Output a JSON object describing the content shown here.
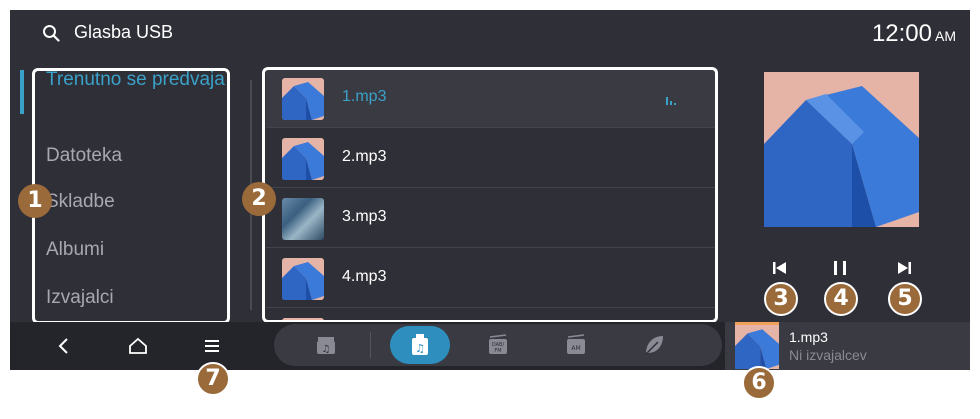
{
  "header": {
    "title": "Glasba USB",
    "time": "12:00",
    "ampm": "AM"
  },
  "menu": {
    "items": [
      {
        "label": "Trenutno se predvaja",
        "active": true
      },
      {
        "label": "Datoteka"
      },
      {
        "label": "Skladbe"
      },
      {
        "label": "Albumi"
      },
      {
        "label": "Izvajalci"
      }
    ]
  },
  "tracks": [
    {
      "name": "1.mp3",
      "playing": true
    },
    {
      "name": "2.mp3"
    },
    {
      "name": "3.mp3"
    },
    {
      "name": "4.mp3"
    }
  ],
  "now_playing": {
    "title": "1.mp3",
    "artist": "Ni izvajalcev"
  },
  "callouts": [
    "1",
    "2",
    "3",
    "4",
    "5",
    "6",
    "7"
  ],
  "icons": {
    "search": "search-icon",
    "back": "back-icon",
    "home": "home-icon",
    "menu": "menu-icon",
    "prev": "previous-track-icon",
    "pause": "pause-icon",
    "next": "next-track-icon",
    "eq": "equalizer-icon"
  },
  "sources": [
    {
      "name": "media-source-icon",
      "active": false
    },
    {
      "name": "usb-music-icon",
      "active": true
    },
    {
      "name": "dab-fm-icon",
      "active": false,
      "text": "DAB/FM"
    },
    {
      "name": "am-radio-icon",
      "active": false,
      "text": "AM"
    },
    {
      "name": "leaf-icon",
      "active": false
    }
  ],
  "colors": {
    "accent": "#3aa1c8",
    "background": "#2f2f37",
    "album": "#e6b4a6",
    "callout": "#9a6a3a"
  }
}
